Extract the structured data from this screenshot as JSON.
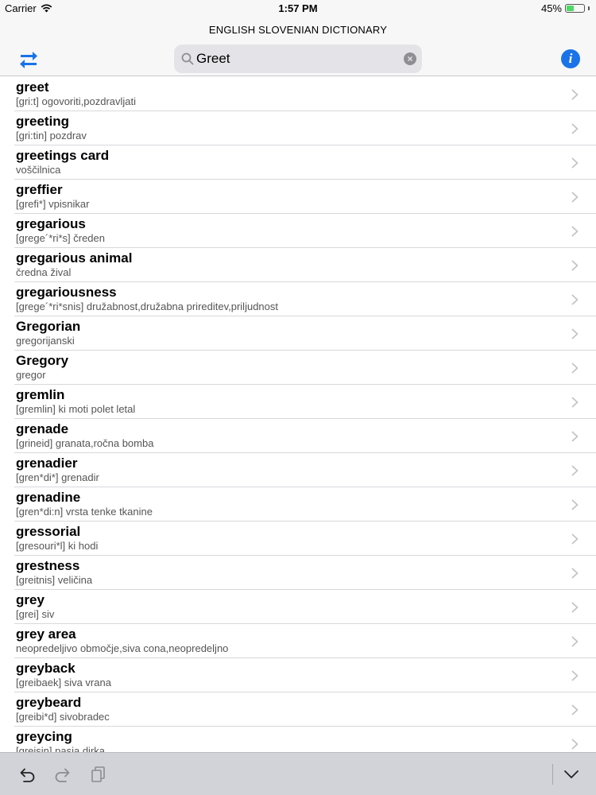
{
  "status": {
    "carrier": "Carrier",
    "time": "1:57 PM",
    "battery_percent": "45%",
    "battery_level": 0.45,
    "battery_color": "#4cd964"
  },
  "header": {
    "title": "ENGLISH SLOVENIAN DICTIONARY",
    "swap_icon": "swap-arrows-icon",
    "info_icon": "info-icon",
    "accent_color": "#1a73e8"
  },
  "search": {
    "value": "Greet",
    "icon": "search-icon",
    "clear_icon": "clear-icon"
  },
  "entries": [
    {
      "word": "greet",
      "translation": "[gri:t] ogovoriti,pozdravljati"
    },
    {
      "word": "greeting",
      "translation": "[gri:tin] pozdrav"
    },
    {
      "word": "greetings card",
      "translation": "voščilnica"
    },
    {
      "word": "greffier",
      "translation": "[grefi*] vpisnikar"
    },
    {
      "word": "gregarious",
      "translation": "[grege´*ri*s] čreden"
    },
    {
      "word": "gregarious animal",
      "translation": "čredna žival"
    },
    {
      "word": "gregariousness",
      "translation": "[grege´*ri*snis] družabnost,družabna prireditev,priljudnost"
    },
    {
      "word": "Gregorian",
      "translation": "gregorijanski"
    },
    {
      "word": "Gregory",
      "translation": "gregor"
    },
    {
      "word": "gremlin",
      "translation": "[gremlin] ki moti polet letal"
    },
    {
      "word": "grenade",
      "translation": "[grineid] granata,ročna bomba"
    },
    {
      "word": "grenadier",
      "translation": "[gren*di*] grenadir"
    },
    {
      "word": "grenadine",
      "translation": "[gren*di:n] vrsta tenke tkanine"
    },
    {
      "word": "gressorial",
      "translation": "[gresouri*l] ki hodi"
    },
    {
      "word": "grestness",
      "translation": "[greitnis] veličina"
    },
    {
      "word": "grey",
      "translation": "[grei] siv"
    },
    {
      "word": "grey area",
      "translation": "neopredeljivo območje,siva cona,neopredeljno"
    },
    {
      "word": "greyback",
      "translation": "[greibaek] siva vrana"
    },
    {
      "word": "greybeard",
      "translation": "[greibi*d] sivobradec"
    },
    {
      "word": "greycing",
      "translation": "[greisin] pasja dirka"
    }
  ],
  "toolbar": {
    "undo_icon": "undo-icon",
    "redo_icon": "redo-icon",
    "paste_icon": "clipboard-icon",
    "dismiss_icon": "chevron-down-icon"
  }
}
